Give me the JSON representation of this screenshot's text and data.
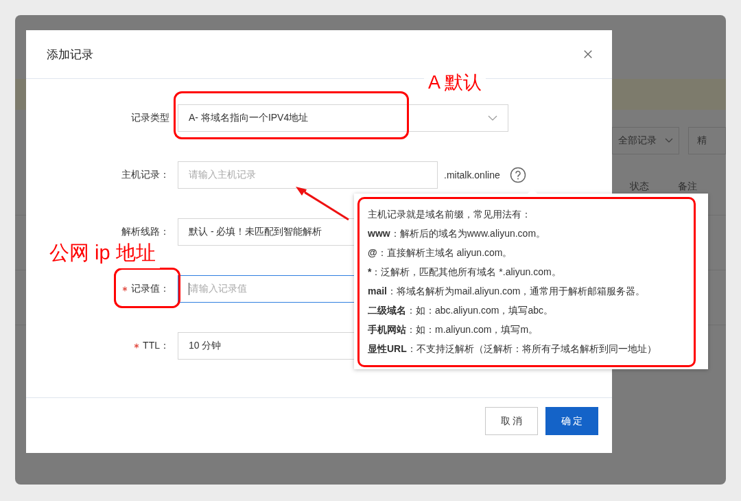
{
  "background": {
    "filter_dropdown": "全部记录",
    "button_text": "精",
    "columns": [
      "状态",
      "备注"
    ]
  },
  "modal": {
    "title": "添加记录",
    "fields": [
      {
        "kind": "select",
        "label": "记录类型",
        "required": false,
        "focused": false,
        "value": "A- 将域名指向一个IPV4地址"
      },
      {
        "kind": "input",
        "label": "主机记录：",
        "required": false,
        "focused": false,
        "placeholder": "请输入主机记录",
        "suffix": ".mitalk.online",
        "help": true
      },
      {
        "kind": "input",
        "label": "解析线路：",
        "required": false,
        "focused": false,
        "value": "默认 - 必填！未匹配到智能解析"
      },
      {
        "kind": "input",
        "label": "记录值：",
        "required": true,
        "focused": true,
        "placeholder": "请输入记录值"
      },
      {
        "kind": "input",
        "label": "TTL：",
        "required": true,
        "focused": false,
        "value": "10 分钟"
      }
    ],
    "buttons": [
      {
        "label": "取 消",
        "kind": "default"
      },
      {
        "label": "确 定",
        "kind": "primary"
      }
    ]
  },
  "tooltip": {
    "lines": [
      "主机记录就是域名前缀，常见用法有：",
      "**www**：解析后的域名为www.aliyun.com。",
      "**@**：直接解析主域名 aliyun.com。",
      "*****：泛解析，匹配其他所有域名 *.aliyun.com。",
      "**mail**：将域名解析为mail.aliyun.com，通常用于解析邮箱服务器。",
      "**二级域名**：如：abc.aliyun.com，填写abc。",
      "**手机网站**：如：m.aliyun.com，填写m。",
      "**显性URL**：不支持泛解析（泛解析：将所有子域名解析到同一地址）"
    ]
  },
  "annotations": [
    {
      "kind": "record_type_note",
      "text": "A 默认"
    },
    {
      "kind": "value_note",
      "text": "公网 ip 地址"
    }
  ]
}
